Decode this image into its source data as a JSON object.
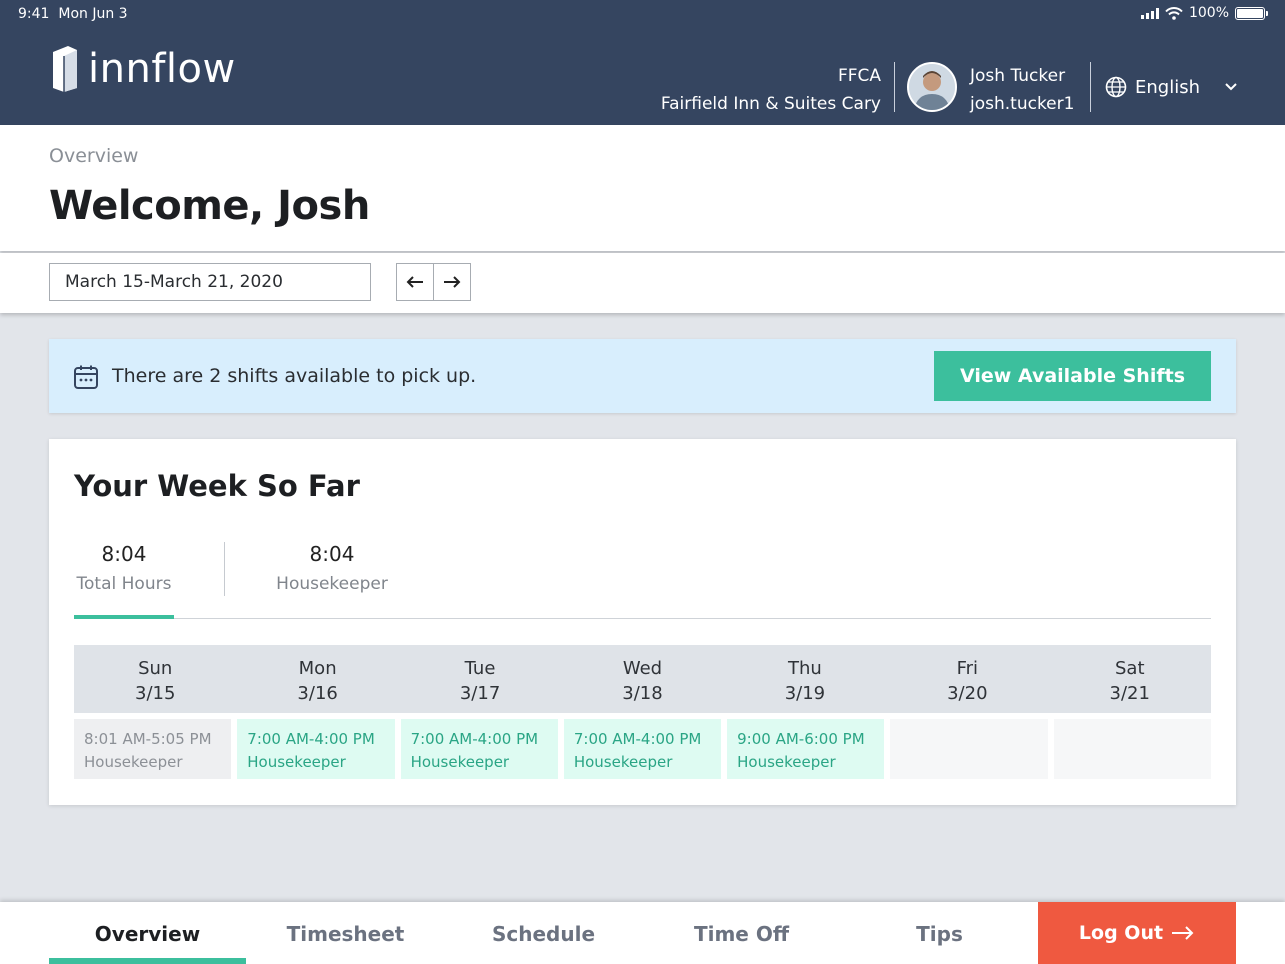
{
  "status_bar": {
    "time": "9:41",
    "date": "Mon Jun 3",
    "battery": "100%"
  },
  "header": {
    "brand": "innflow",
    "property_code": "FFCA",
    "property_name": "Fairfield Inn & Suites Cary",
    "user_name": "Josh Tucker",
    "user_handle": "josh.tucker1",
    "language": "English"
  },
  "overview": {
    "breadcrumb": "Overview",
    "welcome": "Welcome, Josh"
  },
  "date_range": {
    "value": "March 15-March 21, 2020"
  },
  "banner": {
    "message": "There are 2 shifts available to pick up.",
    "button_label": "View Available Shifts"
  },
  "week": {
    "title": "Your Week So Far",
    "stats": [
      {
        "value": "8:04",
        "label": "Total Hours"
      },
      {
        "value": "8:04",
        "label": "Housekeeper"
      }
    ],
    "days": [
      {
        "name": "Sun",
        "date": "3/15"
      },
      {
        "name": "Mon",
        "date": "3/16"
      },
      {
        "name": "Tue",
        "date": "3/17"
      },
      {
        "name": "Wed",
        "date": "3/18"
      },
      {
        "name": "Thu",
        "date": "3/19"
      },
      {
        "name": "Fri",
        "date": "3/20"
      },
      {
        "name": "Sat",
        "date": "3/21"
      }
    ],
    "shifts": [
      {
        "time": "8:01 AM-5:05 PM",
        "role": "Housekeeper"
      },
      {
        "time": "7:00 AM-4:00 PM",
        "role": "Housekeeper"
      },
      {
        "time": "7:00 AM-4:00 PM",
        "role": "Housekeeper"
      },
      {
        "time": "7:00 AM-4:00 PM",
        "role": "Housekeeper"
      },
      {
        "time": "9:00 AM-6:00 PM",
        "role": "Housekeeper"
      }
    ]
  },
  "nav": {
    "overview": "Overview",
    "timesheet": "Timesheet",
    "schedule": "Schedule",
    "time_off": "Time Off",
    "tips": "Tips",
    "logout": "Log Out"
  },
  "colors": {
    "header": "#354560",
    "accent": "#3cbf9d",
    "logout": "#ef5940",
    "banner": "#d8eefd"
  }
}
